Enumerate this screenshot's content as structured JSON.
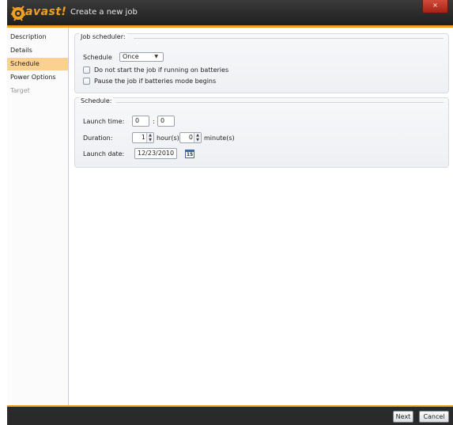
{
  "window": {
    "title": "Create a new job",
    "close_glyph": "×"
  },
  "brand": {
    "logo_text": "avast!",
    "accent": "#f0a020"
  },
  "sidebar": {
    "items": [
      {
        "label": "Description",
        "state": "normal"
      },
      {
        "label": "Details",
        "state": "normal"
      },
      {
        "label": "Schedule",
        "state": "active"
      },
      {
        "label": "Power Options",
        "state": "normal"
      },
      {
        "label": "Target",
        "state": "disabled"
      }
    ]
  },
  "job_scheduler": {
    "legend": "Job scheduler:",
    "schedule_label": "Schedule",
    "schedule_value": "Once",
    "options": [
      {
        "label": "Do not start the job if running on batteries",
        "checked": false
      },
      {
        "label": "Pause the job if batteries mode begins",
        "checked": false
      }
    ]
  },
  "schedule": {
    "legend": "Schedule:",
    "launch_time_label": "Launch time:",
    "hour_value": "0",
    "time_sep": ":",
    "minute_value": "0",
    "duration_label": "Duration:",
    "duration_hours": "1",
    "hours_unit": "hour(s)",
    "duration_minutes": "0",
    "minutes_unit": "minute(s)",
    "launch_date_label": "Launch date:",
    "launch_date_value": "12/23/2010",
    "calendar_day": "15"
  },
  "footer": {
    "next_label": "Next",
    "cancel_label": "Cancel"
  }
}
